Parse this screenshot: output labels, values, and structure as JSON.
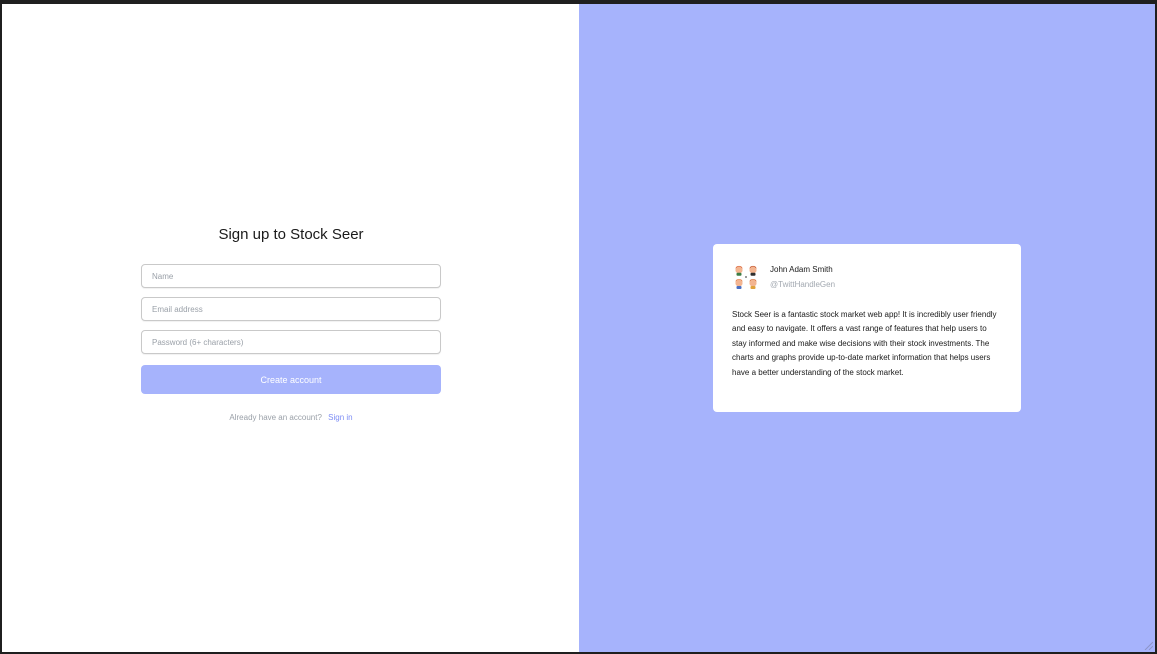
{
  "signup": {
    "title": "Sign up to Stock Seer",
    "name_placeholder": "Name",
    "email_placeholder": "Email address",
    "password_placeholder": "Password (6+ characters)",
    "submit_label": "Create account",
    "signin_prompt": "Already have an account?",
    "signin_link": "Sign in"
  },
  "testimonial": {
    "author_name": "John Adam Smith",
    "author_handle": "@TwittHandleGen",
    "avatar_icon": "avatar-icon",
    "quote": "Stock Seer is a fantastic stock market web app! It is incredibly user friendly and easy to navigate. It offers a vast range of features that help users to stay informed and make wise decisions with their stock investments. The charts and graphs provide up-to-date market information that helps users have a better understanding of the stock market."
  },
  "colors": {
    "accent": "#a6b3fc",
    "link": "#7d8df5",
    "background": "#ffffff"
  }
}
